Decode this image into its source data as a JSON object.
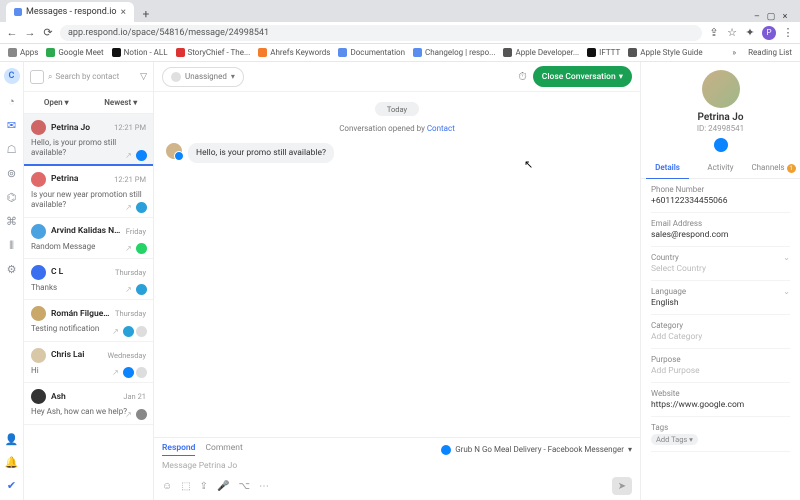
{
  "browser": {
    "tab_title": "Messages - respond.io",
    "url": "app.respond.io/space/54816/message/24998541",
    "bookmarks": [
      {
        "label": "Apps",
        "color": "#888"
      },
      {
        "label": "Google Meet",
        "color": "#2da94f"
      },
      {
        "label": "Notion - ALL",
        "color": "#111"
      },
      {
        "label": "StoryChief - The...",
        "color": "#d33"
      },
      {
        "label": "Ahrefs Keywords",
        "color": "#f47c2b"
      },
      {
        "label": "Documentation",
        "color": "#5b8def"
      },
      {
        "label": "Changelog | respo...",
        "color": "#5b8def"
      },
      {
        "label": "Apple Developer...",
        "color": "#555"
      },
      {
        "label": "IFTTT",
        "color": "#111"
      },
      {
        "label": "Apple Style Guide",
        "color": "#555"
      }
    ],
    "reading_list": "Reading List"
  },
  "search_placeholder": "Search by contact",
  "filters": {
    "status": "Open",
    "sort": "Newest"
  },
  "assignee": "Unassigned",
  "close_btn": "Close Conversation",
  "date_pill": "Today",
  "opened_text": "Conversation opened by ",
  "opened_link": "Contact",
  "inbound_msg": "Hello, is your promo still available?",
  "reply": {
    "tab1": "Respond",
    "tab2": "Comment",
    "channel": "Grub N Go Meal Delivery - Facebook Messenger",
    "placeholder": "Message Petrina Jo"
  },
  "convs": [
    {
      "name": "Petrina Jo",
      "time": "12:21 PM",
      "preview": "Hello, is your promo still available?",
      "av": "#d06565",
      "sel": true,
      "ch": "fb"
    },
    {
      "name": "Petrina",
      "time": "12:21 PM",
      "preview": "Is your new year promotion still available?",
      "av": "#e06a6a",
      "ch": "tg"
    },
    {
      "name": "Arvind Kalidas Nair",
      "time": "Friday",
      "preview": "Random Message",
      "av": "#4aa3e0",
      "ch": "wa"
    },
    {
      "name": "C L",
      "time": "Thursday",
      "preview": "Thanks",
      "av": "#3a6ff0",
      "ch": "tg"
    },
    {
      "name": "Román Filgueira",
      "time": "Thursday",
      "preview": "Testing notification",
      "av": "#c9a86a",
      "ch": "tg",
      "extra": true
    },
    {
      "name": "Chris Lai",
      "time": "Wednesday",
      "preview": "Hi",
      "av": "#d8c8a8",
      "ch": "fb",
      "extra": true
    },
    {
      "name": "Ash",
      "time": "Jan 21",
      "preview": "Hey Ash, how can we help?",
      "av": "#333"
    }
  ],
  "profile": {
    "name": "Petrina Jo",
    "id": "ID: 24998541"
  },
  "side_tabs": {
    "t1": "Details",
    "t2": "Activity",
    "t3": "Channels",
    "badge": "1"
  },
  "fields": [
    {
      "label": "Phone Number",
      "value": "+601122334455066"
    },
    {
      "label": "Email Address",
      "value": "sales@respond.com"
    },
    {
      "label": "Country",
      "value": "Select Country",
      "ph": true,
      "chev": true
    },
    {
      "label": "Language",
      "value": "English",
      "chev": true
    },
    {
      "label": "Category",
      "value": "Add Category",
      "ph": true
    },
    {
      "label": "Purpose",
      "value": "Add Purpose",
      "ph": true
    },
    {
      "label": "Website",
      "value": "https://www.google.com"
    },
    {
      "label": "Tags",
      "tag": "Add Tags"
    }
  ]
}
